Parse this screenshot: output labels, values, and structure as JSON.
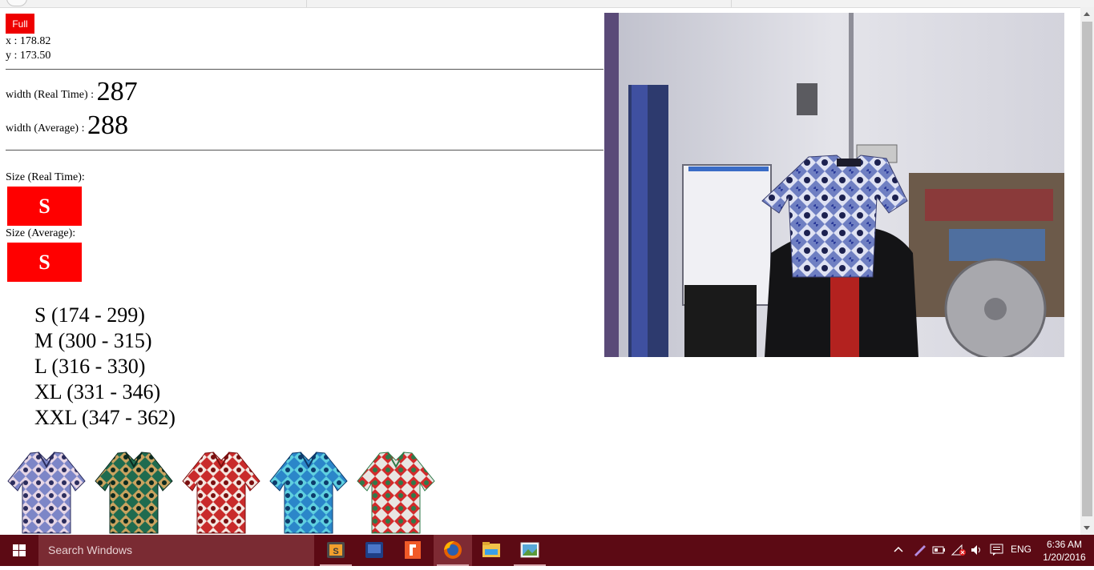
{
  "controls": {
    "full_label": "Full"
  },
  "coords": {
    "x": "x : 178.82",
    "y": "y : 173.50"
  },
  "width": {
    "realtime_label": "width (Real Time) : ",
    "realtime_value": "287",
    "average_label": "width (Average) : ",
    "average_value": "288"
  },
  "size": {
    "realtime_label": "Size (Real Time):",
    "realtime_value": "S",
    "average_label": "Size (Average):",
    "average_value": "S"
  },
  "size_table": [
    "S (174 - 299)",
    "M (300 - 315)",
    "L (316 - 330)",
    "XL (331 - 346)",
    "XXL (347 - 362)"
  ],
  "shirts": [
    {
      "name": "blue-batik-shirt",
      "base": "#7d86c7",
      "accent": "#2b2d5e",
      "detail": "#e6d6e6"
    },
    {
      "name": "green-batik-shirt",
      "base": "#1f6b4f",
      "accent": "#0b2a1f",
      "detail": "#c9a35f"
    },
    {
      "name": "red-batik-shirt",
      "base": "#c92b2b",
      "accent": "#7a0f0f",
      "detail": "#f4e6e0"
    },
    {
      "name": "turquoise-batik-shirt",
      "base": "#2b86c9",
      "accent": "#0d3a6b",
      "detail": "#5fd0e0"
    },
    {
      "name": "white-floral-batik-shirt",
      "base": "#e8e6e2",
      "accent": "#2f7a4a",
      "detail": "#d22b2b"
    }
  ],
  "taskbar": {
    "search_placeholder": "Search Windows",
    "language": "ENG",
    "time": "6:36 AM",
    "date": "1/20/2016",
    "bg_color": "#5c0a14"
  },
  "colors": {
    "accent_red": "#ff0000"
  }
}
